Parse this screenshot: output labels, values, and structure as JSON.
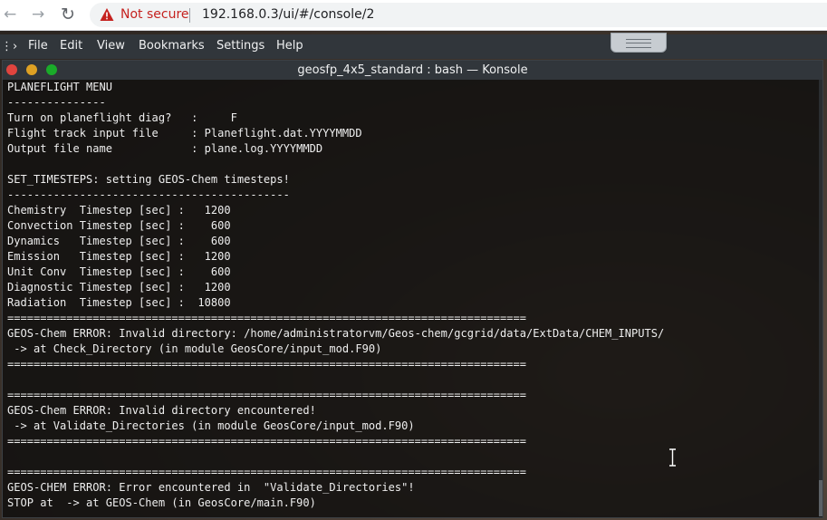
{
  "browser": {
    "security_label": "Not secure",
    "url": "192.168.0.3/ui/#/console/2",
    "back_icon": "arrow-left-icon",
    "forward_icon": "arrow-right-icon",
    "reload_icon": "reload-icon",
    "warning_color": "#c5221f"
  },
  "menubar": {
    "items": [
      "File",
      "Edit",
      "View",
      "Bookmarks",
      "Settings",
      "Help"
    ]
  },
  "window": {
    "title": "geosfp_4x5_standard : bash — Konsole",
    "controls": [
      "close",
      "minimize",
      "maximize"
    ]
  },
  "terminal": {
    "lines": [
      "PLANEFLIGHT MENU",
      "---------------",
      "Turn on planeflight diag?   :     F",
      "Flight track input file     : Planeflight.dat.YYYYMMDD",
      "Output file name            : plane.log.YYYYMMDD",
      "",
      "SET_TIMESTEPS: setting GEOS-Chem timesteps!",
      "-------------------------------------------",
      "Chemistry  Timestep [sec] :   1200",
      "Convection Timestep [sec] :    600",
      "Dynamics   Timestep [sec] :    600",
      "Emission   Timestep [sec] :   1200",
      "Unit Conv  Timestep [sec] :    600",
      "Diagnostic Timestep [sec] :   1200",
      "Radiation  Timestep [sec] :  10800",
      "===============================================================================",
      "GEOS-Chem ERROR: Invalid directory: /home/administratorvm/Geos-chem/gcgrid/data/ExtData/CHEM_INPUTS/",
      " -> at Check_Directory (in module GeosCore/input_mod.F90)",
      "===============================================================================",
      "",
      "===============================================================================",
      "GEOS-Chem ERROR: Invalid directory encountered!",
      " -> at Validate_Directories (in module GeosCore/input_mod.F90)",
      "===============================================================================",
      "",
      "===============================================================================",
      "GEOS-CHEM ERROR: Error encountered in  \"Validate_Directories\"!",
      "STOP at  -> at GEOS-Chem (in GeosCore/main.F90)"
    ]
  }
}
